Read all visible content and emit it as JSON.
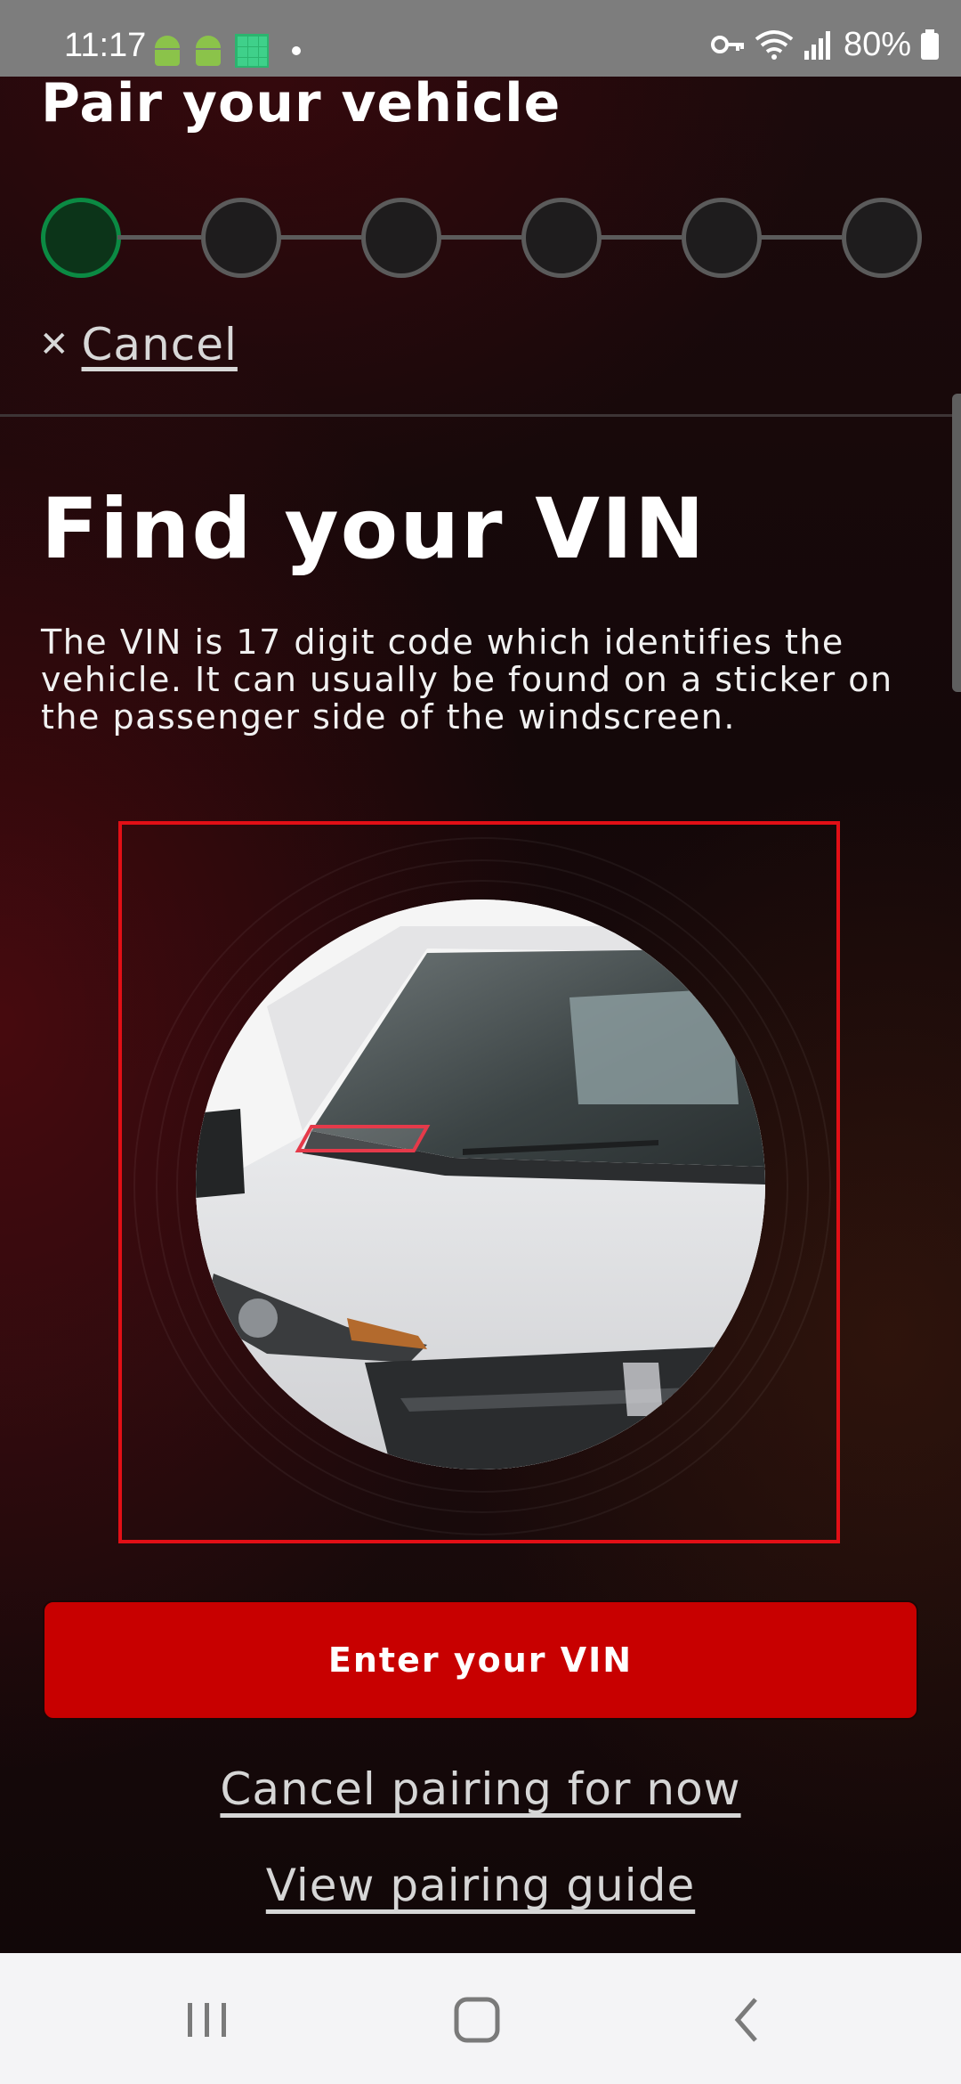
{
  "status_bar": {
    "time": "11:17",
    "battery": "80%",
    "icons": [
      "android-icon",
      "android-icon",
      "grid-icon",
      "dot-icon",
      "key-icon",
      "wifi-icon",
      "signal-icon",
      "battery-icon"
    ]
  },
  "header": {
    "title": "Pair your vehicle",
    "steps_total": 6,
    "current_step": 1,
    "cancel_label": "Cancel"
  },
  "main": {
    "title": "Find your VIN",
    "description": "The VIN is 17 digit code which identifies the vehicle. It can usually be found on a sticker on the passenger side of the windscreen.",
    "illustration_icon": "car-windscreen-vin-illustration",
    "primary_button": "Enter your VIN",
    "cancel_pairing_link": "Cancel pairing for now",
    "guide_link": "View pairing guide"
  },
  "nav_bar": {
    "icons": [
      "recents-icon",
      "home-icon",
      "back-icon"
    ]
  },
  "colors": {
    "accent": "#c80000",
    "active_step": "#0b8a43",
    "highlight_frame": "#e20f16"
  }
}
